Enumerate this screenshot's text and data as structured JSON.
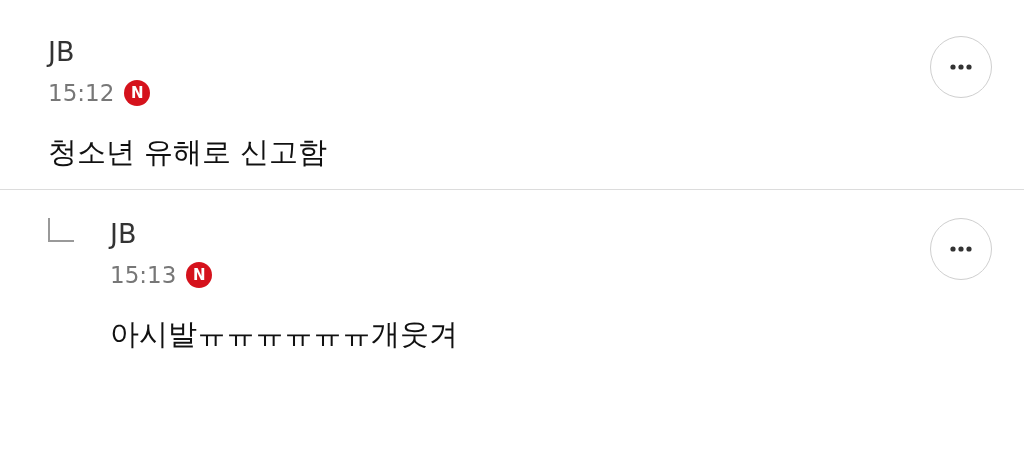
{
  "comments": [
    {
      "author": "JB",
      "time": "15:12",
      "badge": "N",
      "text": "청소년 유해로 신고함",
      "children": [
        {
          "author": "JB",
          "time": "15:13",
          "badge": "N",
          "text": "아시발ㅠㅠㅠㅠㅠㅠ개웃겨"
        }
      ]
    }
  ]
}
